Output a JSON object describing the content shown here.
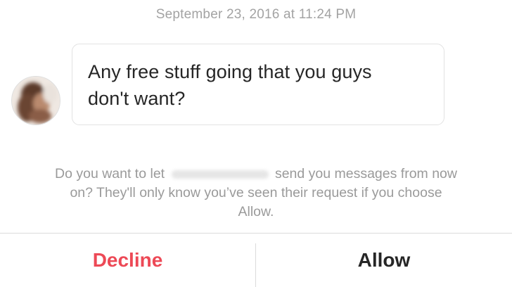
{
  "thread": {
    "timestamp": "September 23, 2016 at 11:24 PM"
  },
  "message": {
    "text_line1": "Any free stuff going that you guys",
    "text_line2": "don't want?"
  },
  "request_prompt": {
    "prefix": "Do you want to let",
    "suffix": "send you messages from now",
    "line2": "on? They'll only know you’ve seen their request if you choose",
    "line3": "Allow."
  },
  "actions": {
    "decline_label": "Decline",
    "allow_label": "Allow"
  },
  "colors": {
    "decline": "#ed4956",
    "allow": "#262626",
    "muted_text": "#9a9a9a",
    "bubble_border": "#e2e2e2"
  },
  "icons": {
    "avatar": "profile-photo-blurred"
  }
}
